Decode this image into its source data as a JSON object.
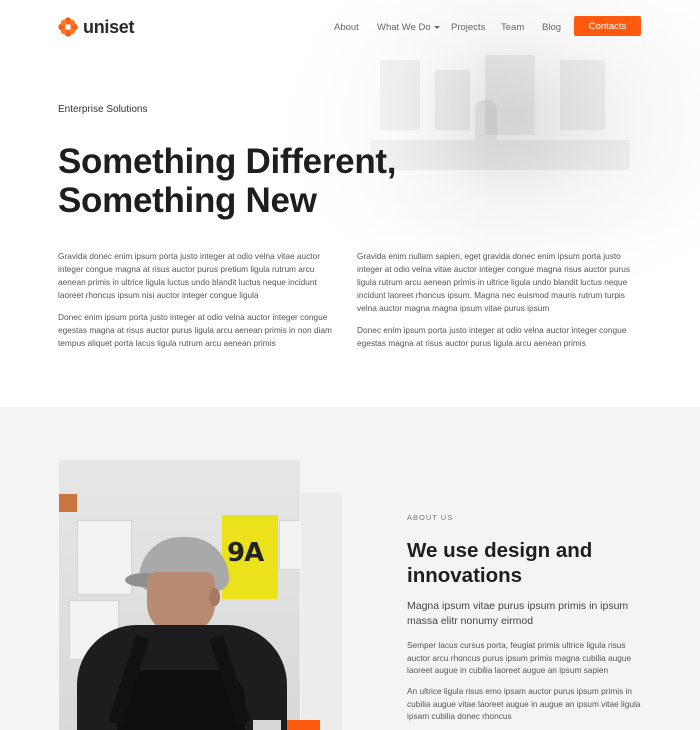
{
  "brand": {
    "name": "uniset",
    "accent": "#ff5b0f"
  },
  "nav": {
    "about": "About",
    "what_we_do": "What We Do",
    "projects": "Projects",
    "team": "Team",
    "blog": "Blog",
    "contacts": "Contacts"
  },
  "hero": {
    "eyebrow": "Enterprise Solutions",
    "title_line1": "Something Different,",
    "title_line2": "Something New",
    "left_p1": "Gravida donec enim ipsum porta justo integer at odio velna vitae auctor integer congue magna at risus auctor purus pretium ligula rutrum arcu aenean primis in ultrice ligula luctus undo blandit luctus neque incidunt laoreet rhoncus ipsum nisi auctor integer congue ligula",
    "left_p2": "Donec enim ipsum porta justo integer at odio velna auctor integer congue egestas magna at risus auctor purus ligula arcu aenean primis in non diam tempus aliquet porta lacus ligula rutrum arcu aenean primis",
    "right_p1": "Gravida enim nullam sapien, eget gravida donec enim ipsum porta justo integer at odio velna vitae auctor integer congue magna risus auctor purus ligula rutrum arcu aenean primis in ultrice ligula undo blandit luctus neque incidunt laoreet rhoncus ipsum. Magna nec euismod mauris rutrum turpis velna auctor magna magna ipsum vitae purus ipsum",
    "right_p2": "Donec enim ipsum porta justo integer at odio velna auctor integer congue egestas magna at risus auctor purus ligula arcu aenean primis"
  },
  "about": {
    "eyebrow": "ABOUT US",
    "title": "We use design and innovations",
    "lead": "Magna ipsum vitae purus ipsum primis in ipsum massa elitr nonumy eirmod",
    "p1": "Semper lacus cursus porta, feugiat primis ultrice ligula risus auctor arcu rhoncus purus ipsum primis magna cubilia augue laoreet augue in cubilia laoreet augue an ipsum sapien",
    "p2": "An ultrice ligula risus emo ipsam auctor purus ipsum primis in cubilia augue vitae laoreet augue in augue an ipsum vitae ligula ipsam cubilia donec rhoncus",
    "photo_poster_text": "9A"
  }
}
